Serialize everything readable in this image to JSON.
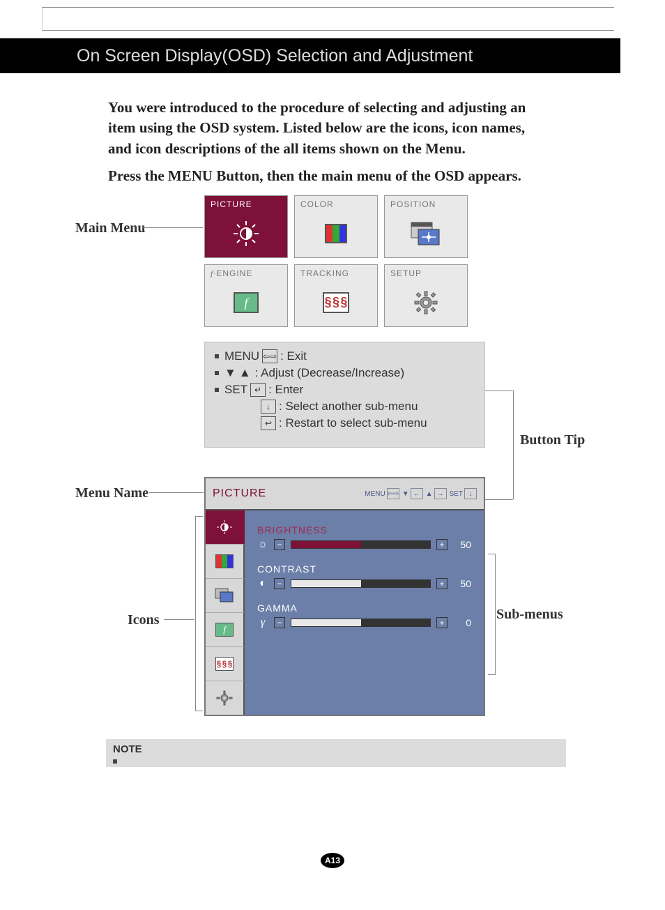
{
  "header": {
    "title": "On Screen Display(OSD) Selection and Adjustment"
  },
  "intro": "You were introduced to the procedure of selecting and adjusting an item using the OSD system.  Listed below are the icons, icon names, and icon descriptions of the all items shown on the Menu.",
  "press_line": "Press the MENU Button, then the main menu of the OSD appears.",
  "labels": {
    "main_menu": "Main Menu",
    "menu_name": "Menu Name",
    "icons": "Icons",
    "sub_menus": "Sub-menus",
    "button_tip": "Button Tip",
    "note": "NOTE"
  },
  "main_menu": [
    {
      "name": "PICTURE",
      "active": true
    },
    {
      "name": "COLOR"
    },
    {
      "name": "POSITION"
    },
    {
      "name": "ENGINE",
      "prefix": "f·"
    },
    {
      "name": "TRACKING"
    },
    {
      "name": "SETUP"
    }
  ],
  "tips": {
    "menu_label": "MENU",
    "menu_desc": ": Exit",
    "adjust_desc": ": Adjust (Decrease/Increase)",
    "set_label": "SET",
    "set_desc": ": Enter",
    "select_desc": ": Select another sub-menu",
    "restart_desc": ": Restart to select sub-menu"
  },
  "osd": {
    "title": "PICTURE",
    "keys": {
      "menu": "MENU",
      "set": "SET"
    },
    "items": [
      {
        "name": "BRIGHTNESS",
        "value": "50",
        "active": true,
        "fill": 50
      },
      {
        "name": "CONTRAST",
        "value": "50",
        "fill": 50
      },
      {
        "name": "GAMMA",
        "value": "0",
        "fill": 50
      }
    ]
  },
  "page_number": "A13"
}
